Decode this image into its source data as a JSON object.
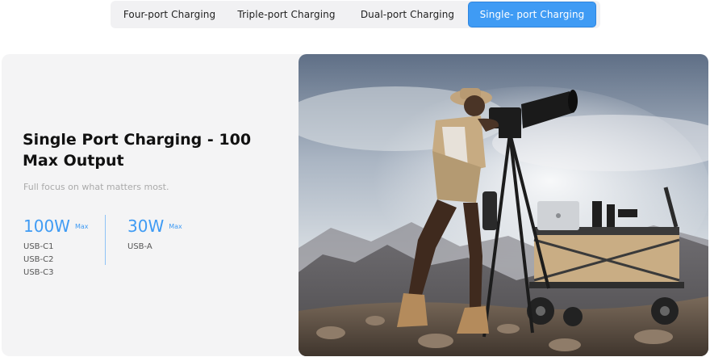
{
  "tabs": [
    {
      "label": "Four-port Charging"
    },
    {
      "label": "Triple-port Charging"
    },
    {
      "label": "Dual-port Charging"
    },
    {
      "label": "Single- port Charging"
    }
  ],
  "headline": "Single Port Charging - 100 Max Output",
  "tagline": "Full focus on what matters most.",
  "specs": [
    {
      "value": "100W",
      "unit": "Max",
      "ports": [
        "USB-C1",
        "USB-C2",
        "USB-C3"
      ]
    },
    {
      "value": "30W",
      "unit": "Max",
      "ports": [
        "USB-A"
      ]
    }
  ],
  "photo": {
    "description_icon": "photographer-image"
  },
  "colors": {
    "accent": "#3f9bf4",
    "panel": "#f4f4f5",
    "tabbar": "#f1f1f3"
  }
}
